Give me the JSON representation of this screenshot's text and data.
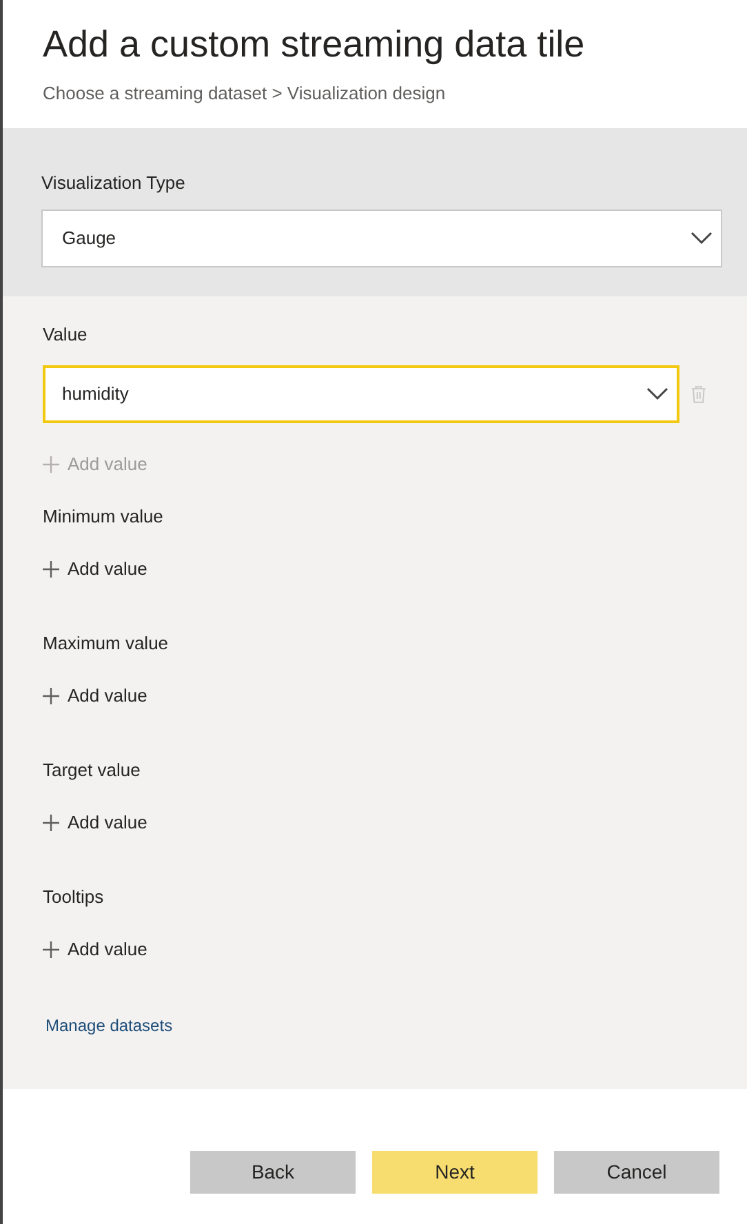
{
  "title": "Add a custom streaming data tile",
  "breadcrumb": "Choose a streaming dataset > Visualization design",
  "visualization_type": {
    "label": "Visualization Type",
    "value": "Gauge"
  },
  "fields": [
    {
      "label": "Value",
      "value": "humidity",
      "focused": true,
      "add_value": {
        "label": "Add value",
        "disabled": true
      }
    },
    {
      "label": "Minimum value",
      "add_value": {
        "label": "Add value",
        "disabled": false
      }
    },
    {
      "label": "Maximum value",
      "add_value": {
        "label": "Add value",
        "disabled": false
      }
    },
    {
      "label": "Target value",
      "add_value": {
        "label": "Add value",
        "disabled": false
      }
    },
    {
      "label": "Tooltips",
      "add_value": {
        "label": "Add value",
        "disabled": false
      }
    }
  ],
  "link": "Manage datasets",
  "buttons": [
    {
      "label": "Back",
      "kind": "secondary"
    },
    {
      "label": "Next",
      "kind": "primary"
    },
    {
      "label": "Cancel",
      "kind": "secondary"
    }
  ]
}
